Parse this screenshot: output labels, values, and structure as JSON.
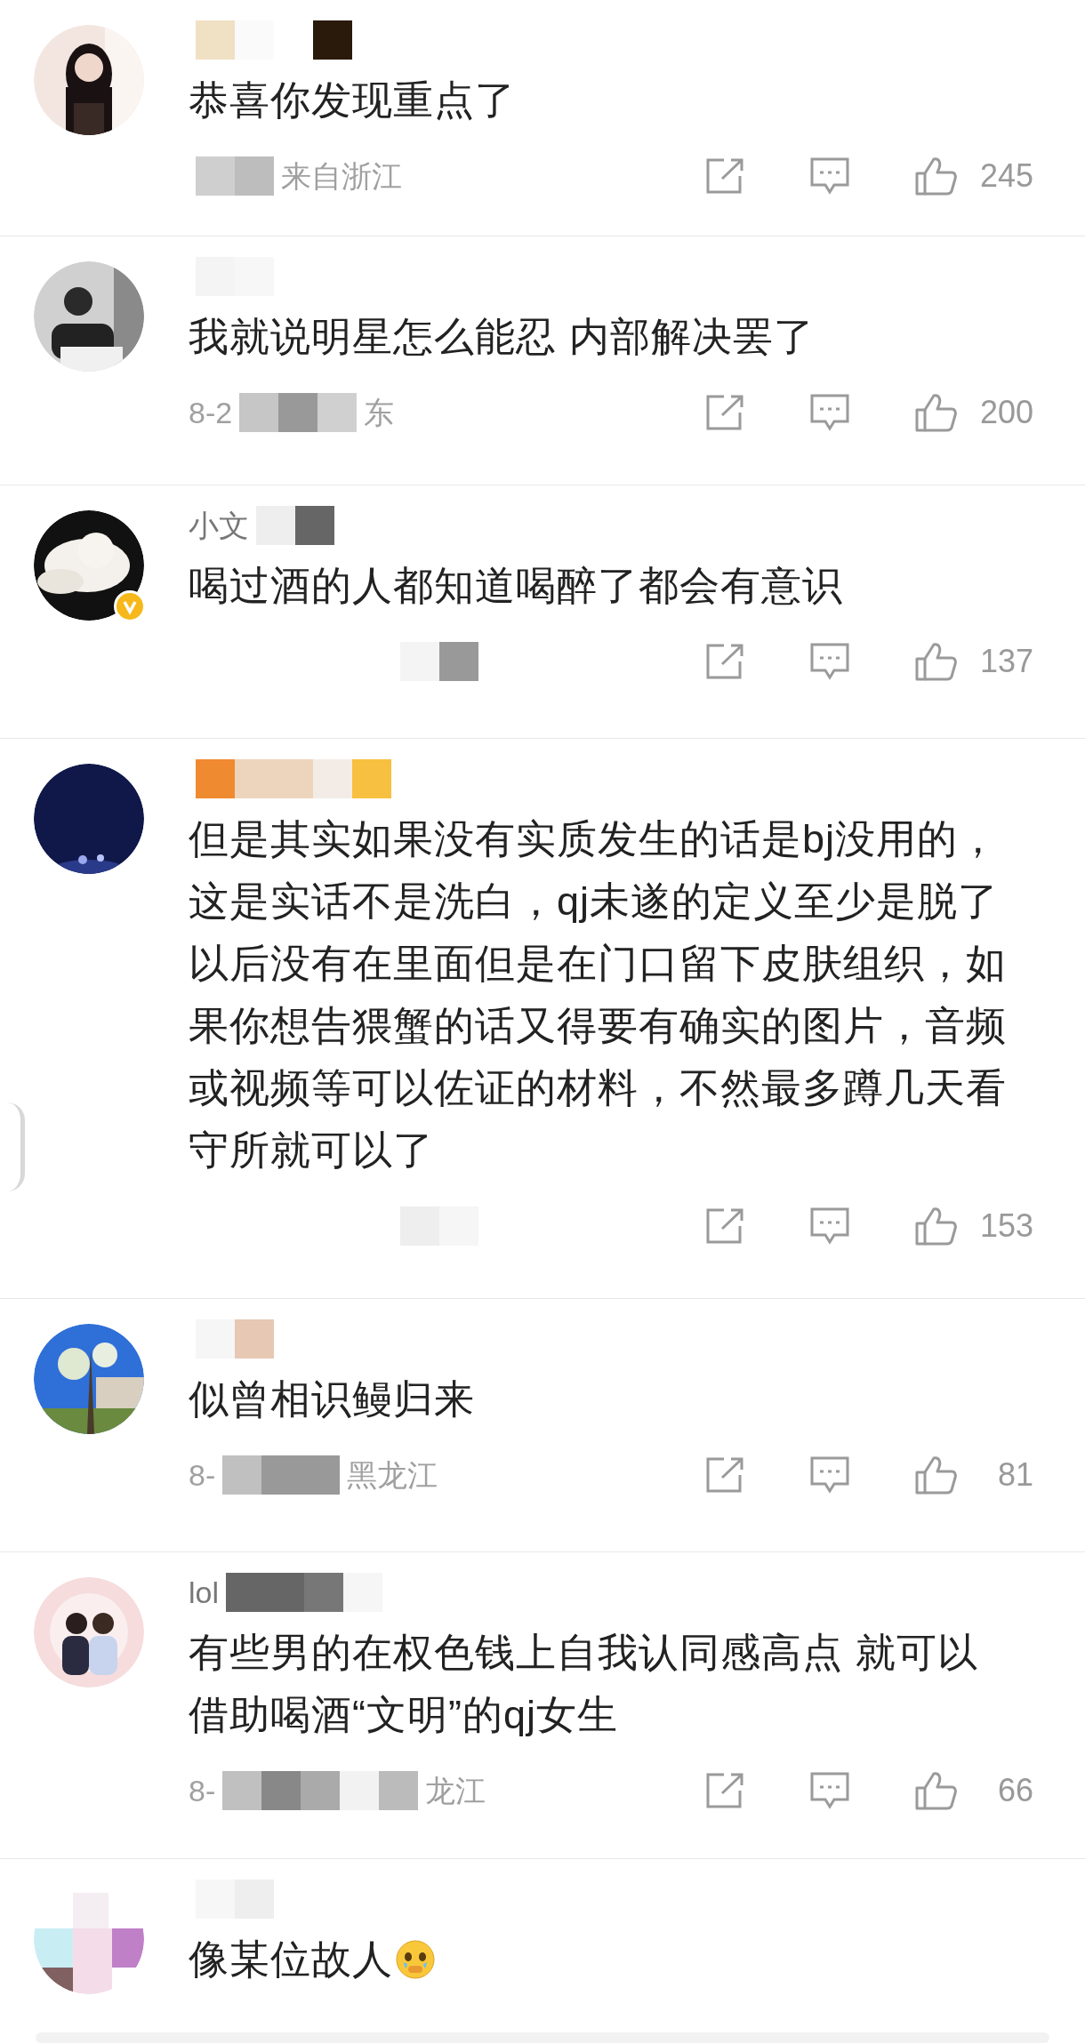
{
  "comments": [
    {
      "text": "恭喜你发现重点了",
      "meta": [
        "来自浙江"
      ],
      "likes": "245"
    },
    {
      "text": "我就说明星怎么能忍 内部解决罢了",
      "meta": [
        "8-2",
        "东"
      ],
      "likes": "200"
    },
    {
      "username": "小文",
      "text": "喝过酒的人都知道喝醉了都会有意识",
      "likes": "137",
      "verified": true
    },
    {
      "text": "但是其实如果没有实质发生的话是bj没用的，这是实话不是洗白，qj未遂的定义至少是脱了以后没有在里面但是在门口留下皮肤组织，如果你想告猥蟹的话又得要有确实的图片，音频或视频等可以佐证的材料，不然最多蹲几天看守所就可以了",
      "likes": "153"
    },
    {
      "text": "似曾相识鳗归来",
      "meta": [
        "8-",
        "黑龙江"
      ],
      "likes": "81"
    },
    {
      "username": "lol",
      "text": "有些男的在权色钱上自我认同感高点 就可以借助喝酒“文明”的qj女生",
      "meta": [
        "8-",
        "龙江"
      ],
      "likes": "66"
    },
    {
      "text": "像某位故人",
      "emoji": true
    }
  ]
}
